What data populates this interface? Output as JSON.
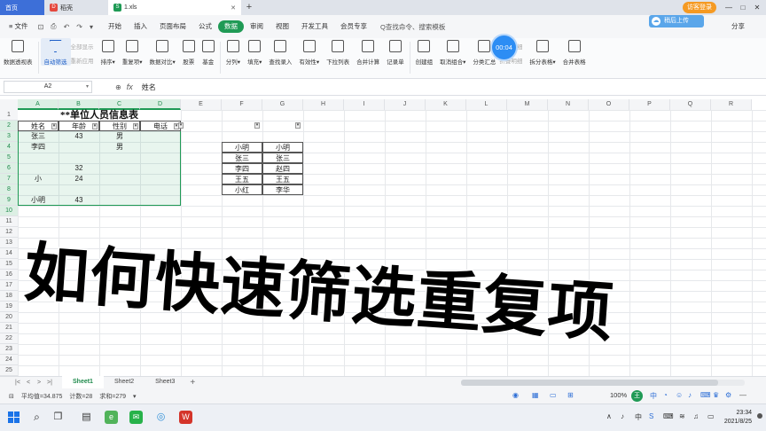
{
  "tabs": {
    "home": "首页",
    "file": "稻壳",
    "doc": "1.xls",
    "new_tab": "+"
  },
  "titlebar": {
    "login": "访客登录",
    "min": "—",
    "max": "□",
    "close": "✕"
  },
  "menu": {
    "file": "≡ 文件",
    "items": [
      "开始",
      "插入",
      "页面布局",
      "公式",
      "数据",
      "审阅",
      "视图",
      "开发工具",
      "会员专享"
    ],
    "active_index": 4,
    "search": "Q查找命令、搜索模板",
    "share": "分享",
    "cloud_pop": "稍后上传"
  },
  "ribbon": {
    "buttons": [
      {
        "label": "数据透视表"
      },
      {
        "label": "自动筛选",
        "active": true
      },
      {
        "small": [
          "全部显示",
          "重新应用"
        ]
      },
      {
        "label": "排序▾"
      },
      {
        "label": "重复项▾"
      },
      {
        "label": "数据对比▾"
      },
      {
        "label": "股票"
      },
      {
        "label": "基金"
      },
      {
        "label": "分列▾"
      },
      {
        "label": "填充▾"
      },
      {
        "label": "查找录入"
      },
      {
        "label": "有效性▾"
      },
      {
        "label": "下拉列表"
      },
      {
        "label": "合并计算"
      },
      {
        "label": "记录单"
      },
      {
        "label": "创建组"
      },
      {
        "label": "取消组合▾"
      },
      {
        "label": "分类汇总"
      },
      {
        "small": [
          "展开明细",
          "折叠明细"
        ]
      },
      {
        "label": "拆分表格▾"
      },
      {
        "label": "合并表格"
      }
    ],
    "timer": "00:04",
    "fenxi": "拟分析"
  },
  "formula": {
    "cell_ref": "A2",
    "fx": "fx",
    "value": "姓名"
  },
  "grid": {
    "columns": [
      "A",
      "B",
      "C",
      "D",
      "E",
      "F",
      "G",
      "H",
      "I",
      "J",
      "K",
      "L",
      "M",
      "N",
      "O",
      "P",
      "Q",
      "R"
    ],
    "rows": [
      "1",
      "2",
      "3",
      "4",
      "5",
      "6",
      "7",
      "8",
      "9",
      "10",
      "11",
      "12",
      "13",
      "14",
      "15",
      "16",
      "17",
      "18",
      "19",
      "20",
      "21",
      "22",
      "23",
      "24",
      "25"
    ],
    "title": "**单位人员信息表",
    "headers": [
      "姓名",
      "年龄",
      "性别",
      "电话"
    ],
    "table_rows": [
      [
        "张三",
        "43",
        "男",
        ""
      ],
      [
        "李四",
        "",
        "男",
        ""
      ],
      [
        "",
        "",
        "",
        ""
      ],
      [
        "",
        "32",
        "",
        ""
      ],
      [
        "小",
        "24",
        "",
        ""
      ],
      [
        "",
        "",
        "",
        ""
      ],
      [
        "小明",
        "43",
        "",
        ""
      ]
    ],
    "list_f": [
      "小明",
      "张三",
      "李四",
      "王五",
      "小红"
    ],
    "list_g": [
      "小明",
      "张三",
      "赵四",
      "王五",
      "李华"
    ],
    "overlay": "如何快速筛选重复项"
  },
  "sheets": {
    "tabs": [
      "Sheet1",
      "Sheet2",
      "Sheet3"
    ],
    "add": "+",
    "nav": [
      "|<",
      "<",
      ">",
      ">|"
    ]
  },
  "status": {
    "avg": "平均值=34.875",
    "count": "计数=28",
    "sum": "求和=279",
    "zoom": "100%",
    "ime": "王",
    "ime_mode": "中"
  },
  "taskbar": {
    "time": "23:34",
    "date": "2021/8/25"
  }
}
